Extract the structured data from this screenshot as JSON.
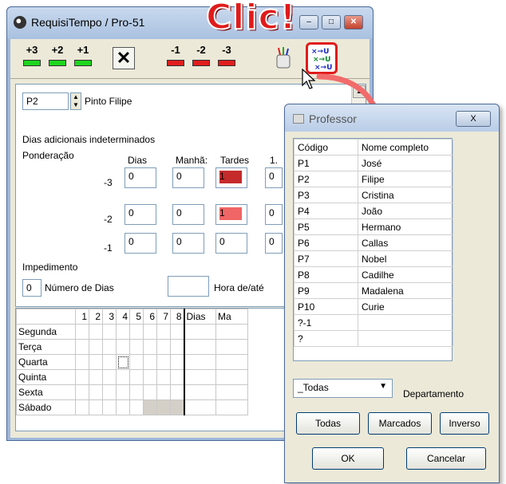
{
  "window": {
    "title": "RequisiTempo / Pro-51",
    "minimize": "–",
    "maximize": "□",
    "close": "✕"
  },
  "toolbar": {
    "plus3": "+3",
    "plus2": "+2",
    "plus1": "+1",
    "clear": "✕",
    "minus1": "-1",
    "minus2": "-2",
    "minus3": "-3"
  },
  "callout": {
    "text": "Clic!"
  },
  "teacher": {
    "code": "P2",
    "name": "Pinto Filipe"
  },
  "section": {
    "dias_adicionais": "Dias adicionais indeterminados",
    "ponderacao": "Ponderação",
    "impedimento": "Impedimento",
    "numero_dias_value": "0",
    "numero_dias_label": "Número de Dias",
    "hora_label": "Hora de/até"
  },
  "weights": {
    "headers": [
      "Dias",
      "Manhã:",
      "Tardes",
      "1."
    ],
    "rows": [
      {
        "label": "-3",
        "dias": "0",
        "manha": "0",
        "tardes": "1",
        "n": "0"
      },
      {
        "label": "-2",
        "dias": "0",
        "manha": "0",
        "tardes": "1",
        "n": "0"
      },
      {
        "label": "-1",
        "dias": "0",
        "manha": "0",
        "tardes": "0",
        "n": "0"
      }
    ]
  },
  "schedule": {
    "columns": [
      "1",
      "2",
      "3",
      "4",
      "5",
      "6",
      "7",
      "8",
      "Dias",
      "Ma"
    ],
    "days": [
      "Segunda",
      "Terça",
      "Quarta",
      "Quinta",
      "Sexta",
      "Sábado"
    ]
  },
  "dialog": {
    "title": "Professor",
    "close": "X",
    "col_code": "Código",
    "col_name": "Nome completo",
    "rows": [
      {
        "code": "P1",
        "name": "José"
      },
      {
        "code": "P2",
        "name": "Filipe"
      },
      {
        "code": "P3",
        "name": "Cristina"
      },
      {
        "code": "P4",
        "name": "João"
      },
      {
        "code": "P5",
        "name": "Hermano"
      },
      {
        "code": "P6",
        "name": "Callas"
      },
      {
        "code": "P7",
        "name": "Nobel"
      },
      {
        "code": "P8",
        "name": "Cadilhe"
      },
      {
        "code": "P9",
        "name": "Madalena"
      },
      {
        "code": "P10",
        "name": "Curie"
      },
      {
        "code": "?-1",
        "name": ""
      },
      {
        "code": "?",
        "name": ""
      }
    ],
    "combo_value": "_Todas",
    "combo_label": "Departamento",
    "btn_todas": "Todas",
    "btn_marcados": "Marcados",
    "btn_inverso": "Inverso",
    "btn_ok": "OK",
    "btn_cancelar": "Cancelar"
  },
  "colors": {
    "accent_red": "#e01b1b",
    "plus_green": "#1fd61f",
    "minus_red": "#e21d1d"
  }
}
